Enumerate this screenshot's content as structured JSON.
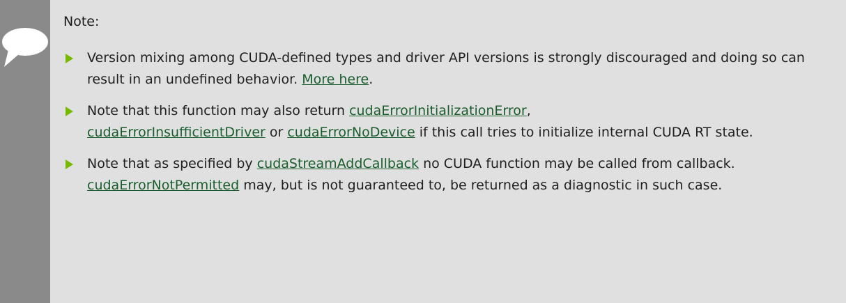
{
  "note": {
    "title": "Note:",
    "items": [
      {
        "t1": "Version mixing among CUDA-defined types and driver API versions is strongly discouraged and doing so can result in an undefined behavior. ",
        "link1": "More here",
        "t2": "."
      },
      {
        "t1": "Note that this function may also return ",
        "link1": "cudaErrorInitializationError",
        "t2": ", ",
        "link2": "cudaErrorInsufficientDriver",
        "t3": " or ",
        "link3": "cudaErrorNoDevice",
        "t4": " if this call tries to initialize internal CUDA RT state."
      },
      {
        "t1": "Note that as specified by ",
        "link1": "cudaStreamAddCallback",
        "t2": " no CUDA function may be called from callback. ",
        "link2": "cudaErrorNotPermitted",
        "t3": " may, but is not guaranteed to, be returned as a diagnostic in such case."
      }
    ]
  },
  "colors": {
    "background": "#e0e0e0",
    "gutter": "#8a8a8a",
    "bullet": "#76b900",
    "link": "#1a5e2e"
  },
  "icons": {
    "gutter_icon": "speech-bubble-icon",
    "bullet_icon": "triangle-bullet-icon"
  }
}
